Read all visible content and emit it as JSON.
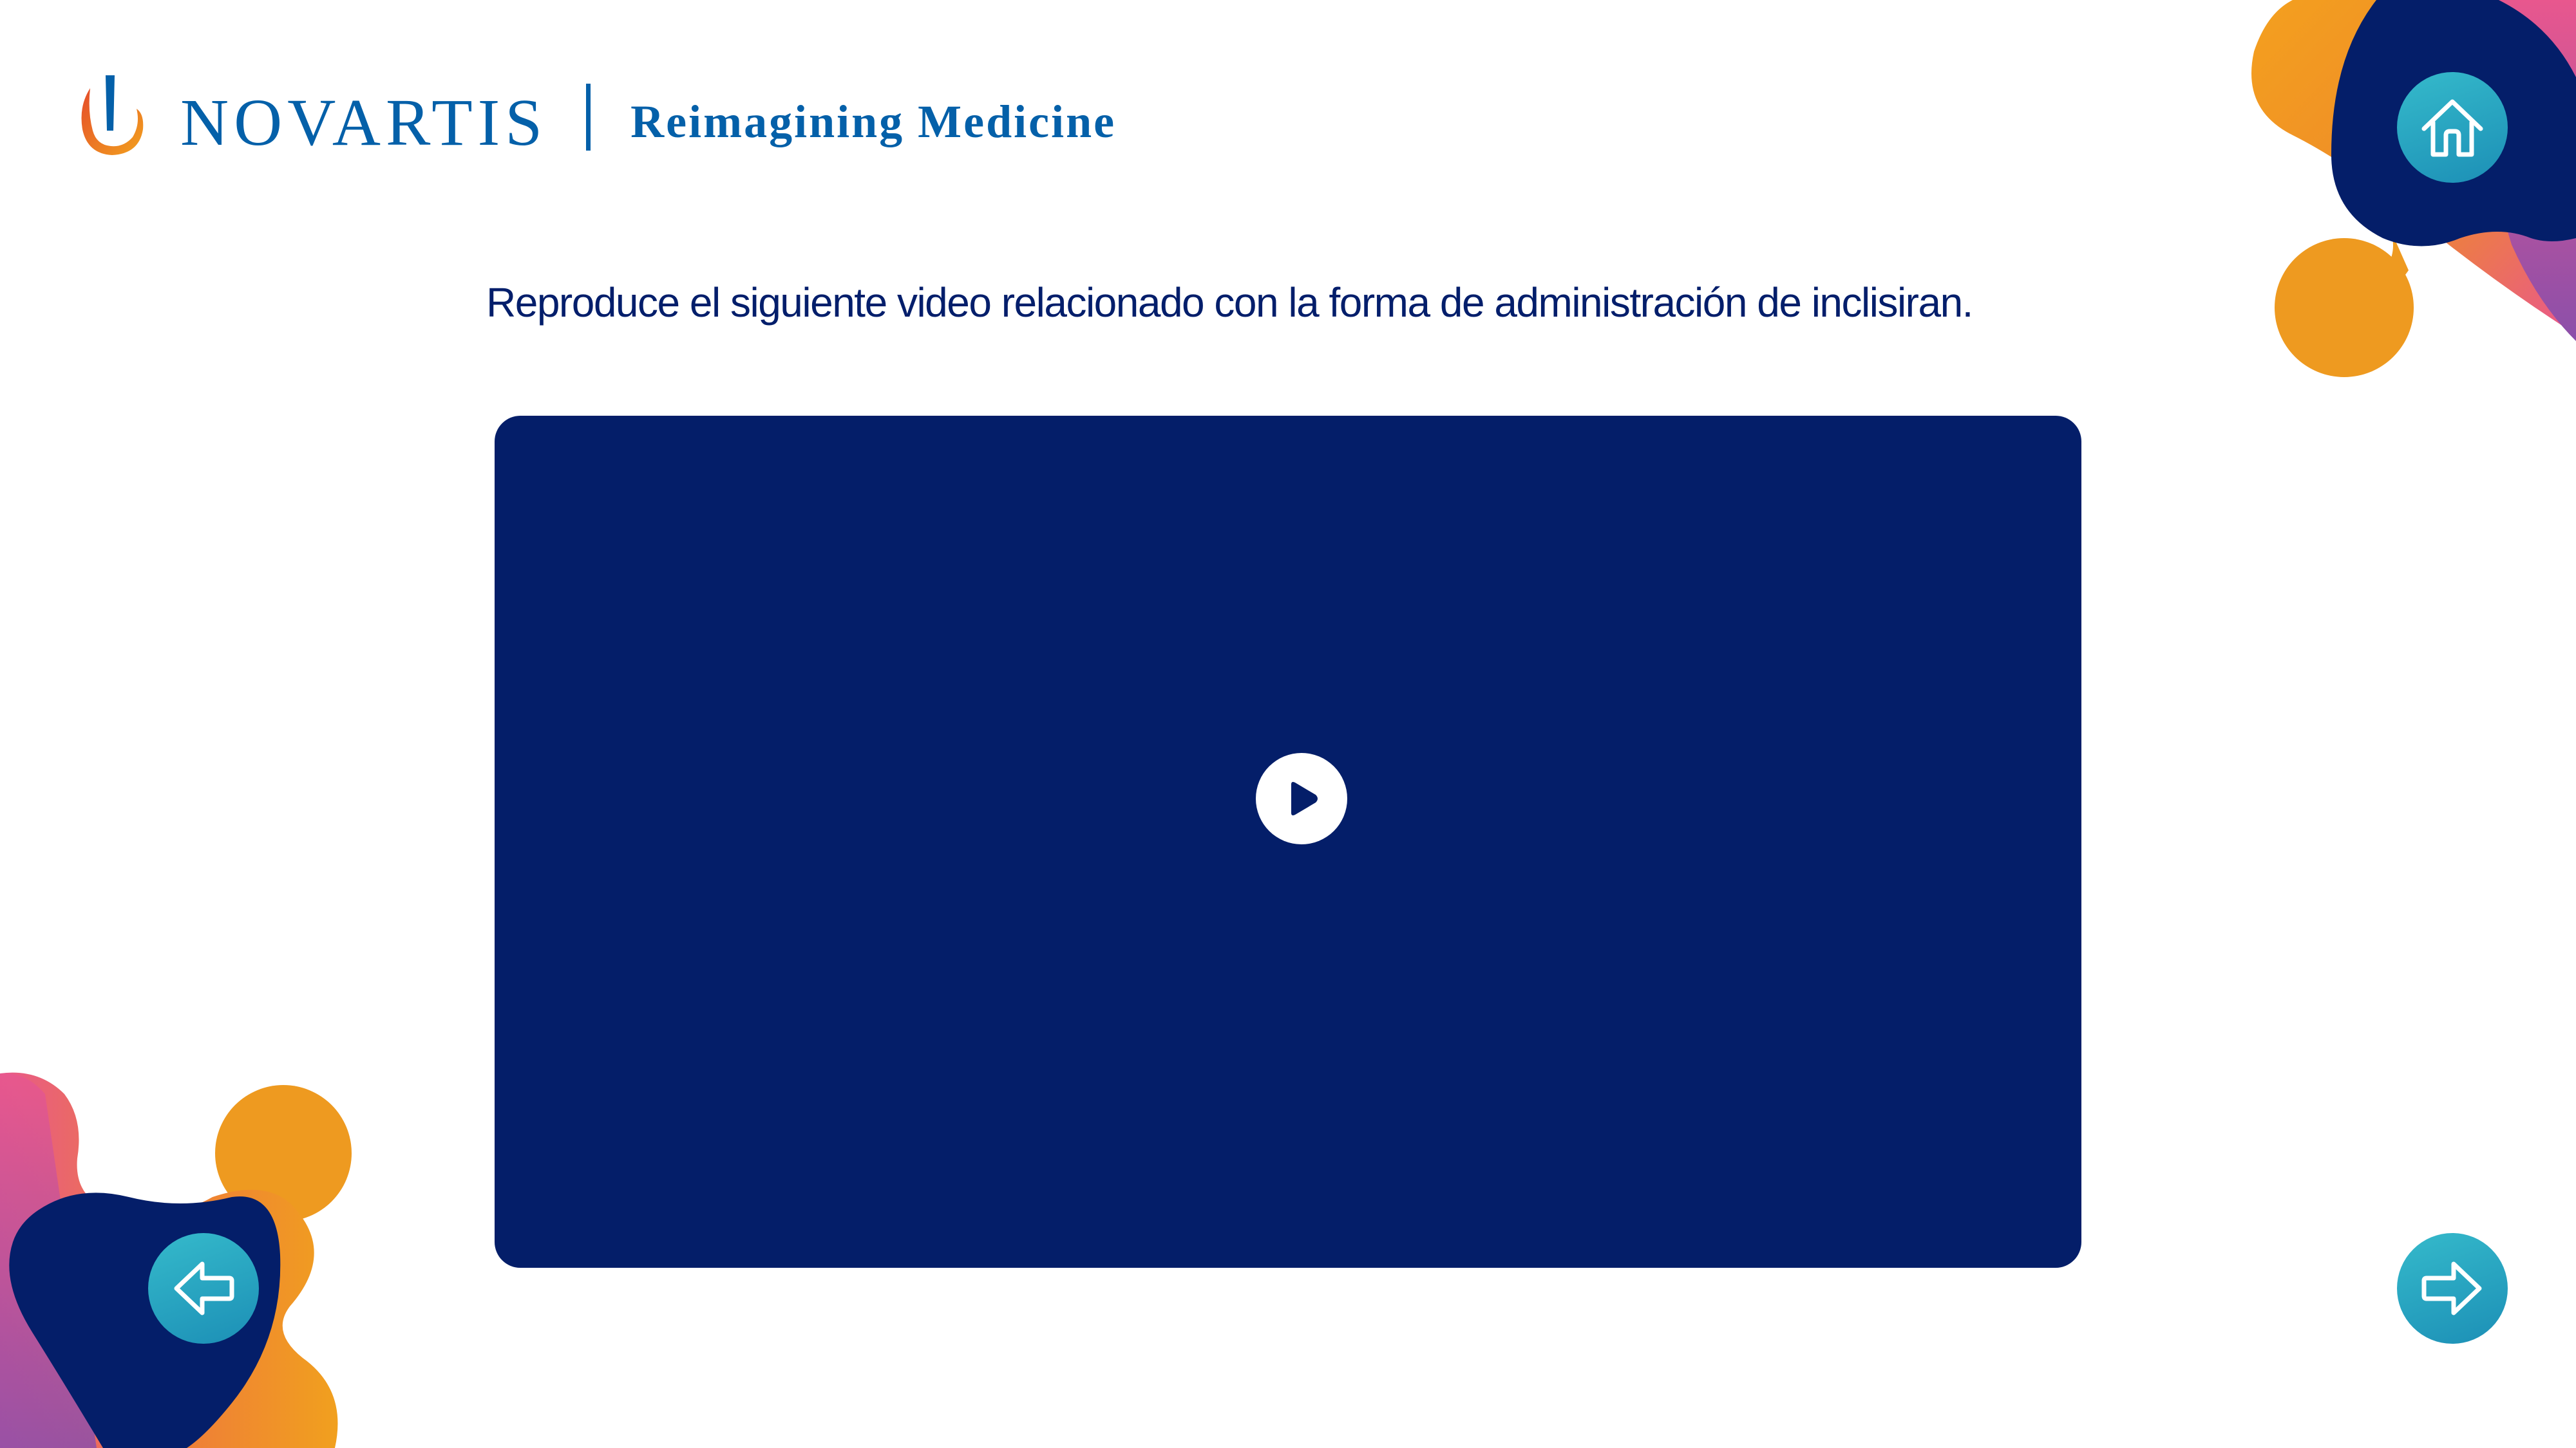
{
  "header": {
    "brand_name": "NOVARTIS",
    "tagline": "Reimagining Medicine"
  },
  "content": {
    "instruction": "Reproduce el siguiente video relacionado con la forma de administración de inclisiran."
  },
  "icons": {
    "home": "home-icon",
    "previous": "arrow-left-icon",
    "next": "arrow-right-icon",
    "play": "play-icon",
    "logo_mark": "novartis-flame-icon"
  },
  "colors": {
    "brand_blue": "#0460A9",
    "navy": "#041E69",
    "orange": "#EE9A20",
    "pink": "#E85A8A",
    "teal": "#2BA5C4",
    "purple": "#8A4FA8"
  }
}
